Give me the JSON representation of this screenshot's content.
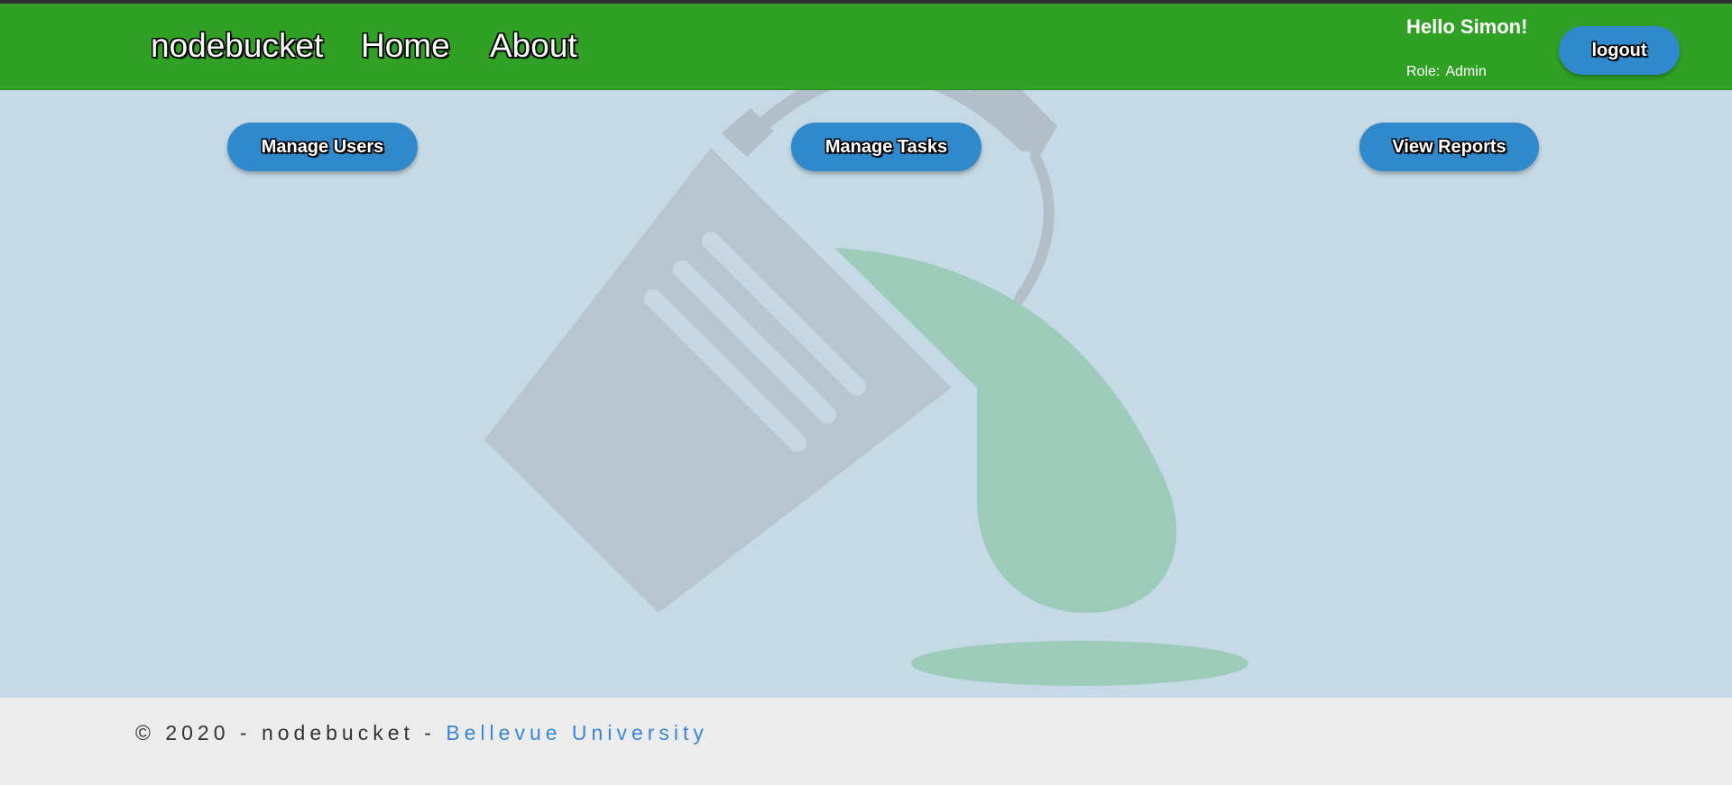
{
  "nav": {
    "brand": "nodebucket",
    "home": "Home",
    "about": "About"
  },
  "user": {
    "greeting": "Hello Simon!",
    "role_label": "Role:",
    "role_value": "Admin",
    "logout_label": "logout"
  },
  "actions": {
    "manage_users": "Manage Users",
    "manage_tasks": "Manage Tasks",
    "view_reports": "View Reports"
  },
  "footer": {
    "copyright": "© 2020 - nodebucket - ",
    "link_text": "Bellevue University"
  },
  "colors": {
    "navbar": "#31a125",
    "button": "#3089cb",
    "page_background": "#c5d9e6",
    "footer_background": "#ececec",
    "footer_link": "#3a86d6"
  },
  "icons": {
    "background": "paint-bucket-illustration"
  }
}
